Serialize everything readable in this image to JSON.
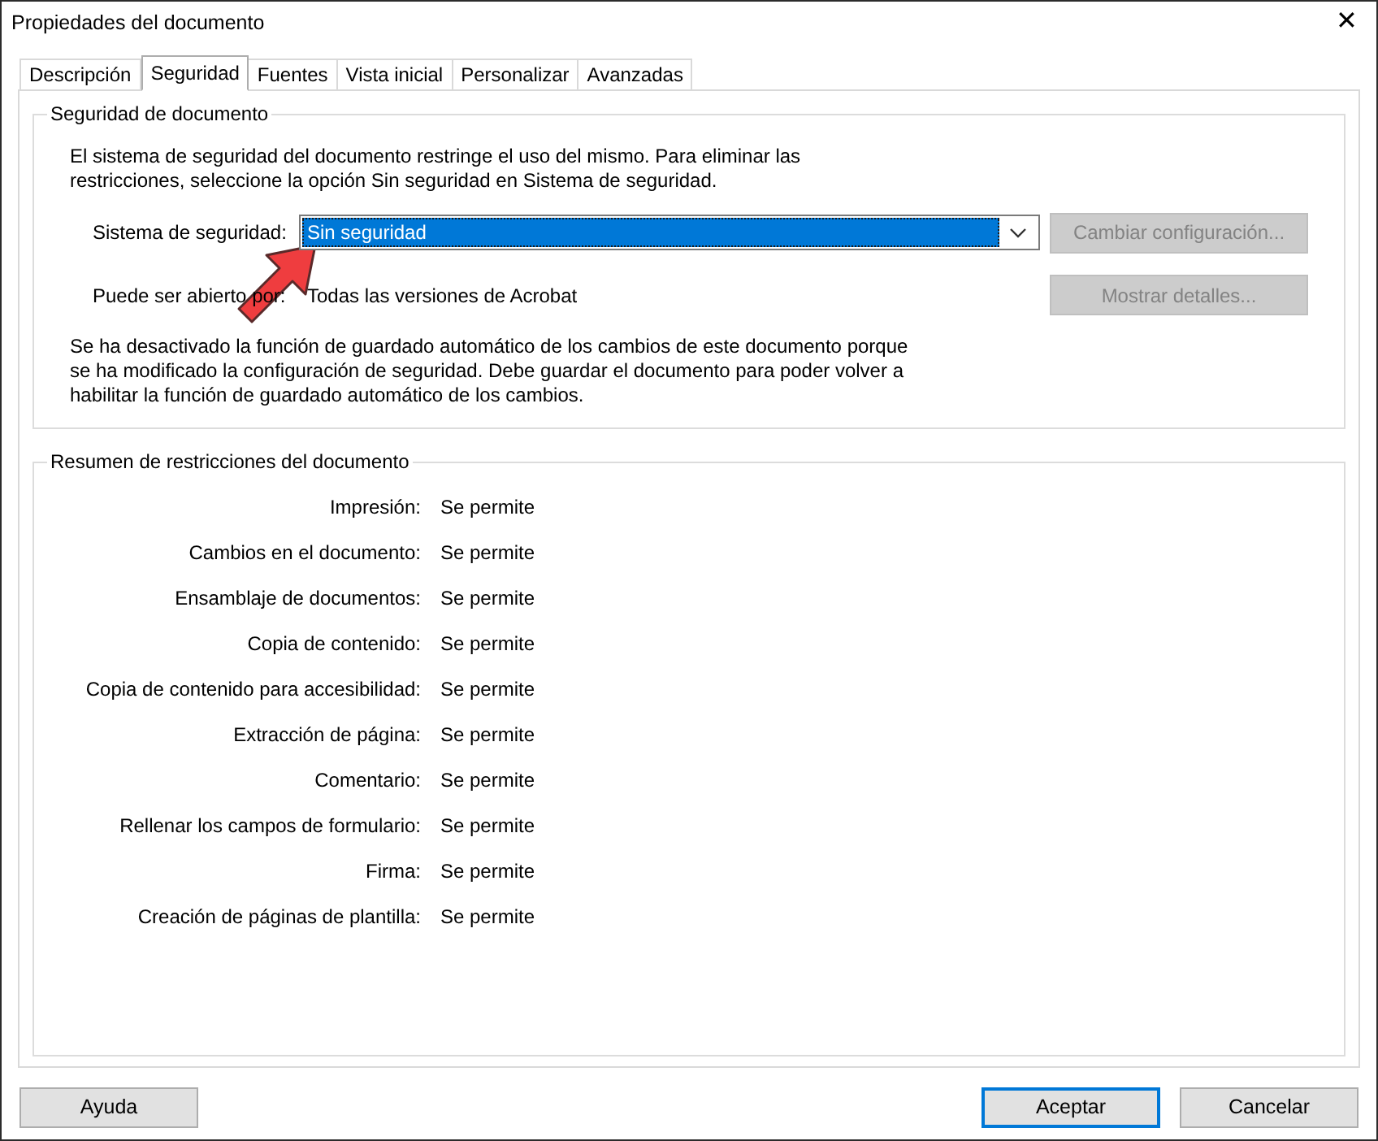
{
  "window": {
    "title": "Propiedades del documento",
    "close": "✕"
  },
  "tabs": [
    {
      "label": "Descripción",
      "selected": false
    },
    {
      "label": "Seguridad",
      "selected": true
    },
    {
      "label": "Fuentes",
      "selected": false
    },
    {
      "label": "Vista inicial",
      "selected": false
    },
    {
      "label": "Personalizar",
      "selected": false
    },
    {
      "label": "Avanzadas",
      "selected": false
    }
  ],
  "security_group": {
    "title": "Seguridad de documento",
    "intro": "El sistema de seguridad del documento restringe el uso del mismo. Para eliminar las restricciones, seleccione la opción Sin seguridad en Sistema de seguridad.",
    "method_label": "Sistema de seguridad:",
    "method_value": "Sin seguridad",
    "change_button": {
      "label": "Cambiar configuración...",
      "disabled": true
    },
    "open_label": "Puede ser abierto por:",
    "open_value": "Todas las versiones de Acrobat",
    "details_button": {
      "label": "Mostrar detalles...",
      "disabled": true
    },
    "note": "Se ha desactivado la función de guardado automático de los cambios de este documento porque se ha modificado la configuración de seguridad. Debe guardar el documento para poder volver a habilitar la función de guardado automático de los cambios."
  },
  "restrictions_group": {
    "title": "Resumen de restricciones del documento",
    "rows": [
      {
        "label": "Impresión:",
        "value": "Se permite"
      },
      {
        "label": "Cambios en el documento:",
        "value": "Se permite"
      },
      {
        "label": "Ensamblaje de documentos:",
        "value": "Se permite"
      },
      {
        "label": "Copia de contenido:",
        "value": "Se permite"
      },
      {
        "label": "Copia de contenido para accesibilidad:",
        "value": "Se permite"
      },
      {
        "label": "Extracción de página:",
        "value": "Se permite"
      },
      {
        "label": "Comentario:",
        "value": "Se permite"
      },
      {
        "label": "Rellenar los campos de formulario:",
        "value": "Se permite"
      },
      {
        "label": "Firma:",
        "value": "Se permite"
      },
      {
        "label": "Creación de páginas de plantilla:",
        "value": "Se permite"
      }
    ]
  },
  "buttons": [
    {
      "label": "Ayuda",
      "default": false
    },
    {
      "label": "Aceptar",
      "default": true
    },
    {
      "label": "Cancelar",
      "default": false
    }
  ]
}
